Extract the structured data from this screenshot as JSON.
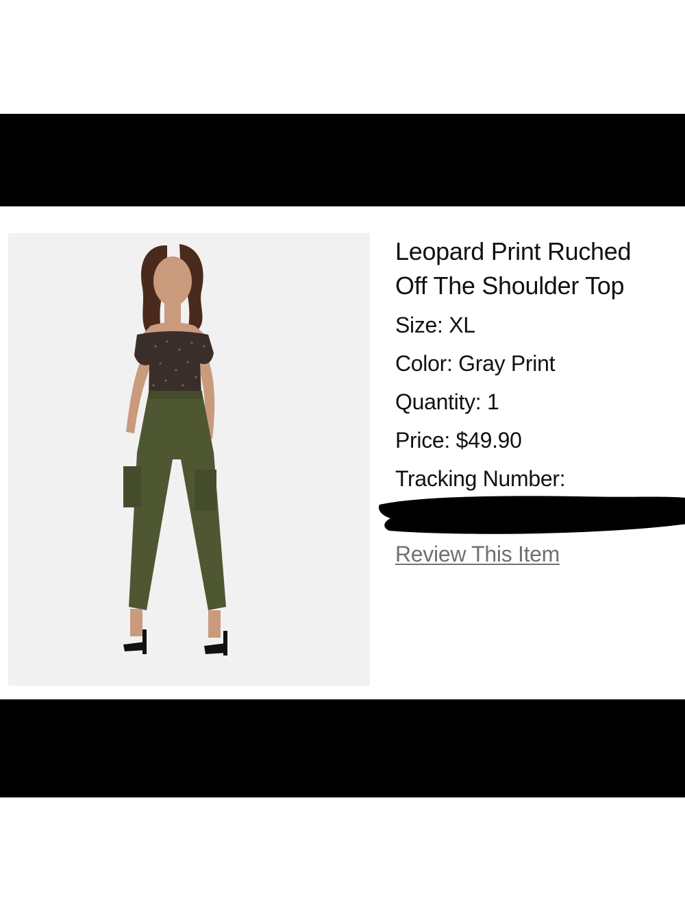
{
  "product": {
    "title_line1": "Leopard Print Ruched",
    "title_line2": "Off The Shoulder Top",
    "size": "Size: XL",
    "color": "Color: Gray Print",
    "quantity": "Quantity: 1",
    "price": "Price: $49.90",
    "tracking_label": "Tracking Number:",
    "review_link": "Review This Item"
  },
  "colors": {
    "bars": "#000000",
    "photo_background": "#f1f1f1",
    "link": "#707070",
    "top": "#3a2e2b",
    "pants": "#4f5732"
  }
}
